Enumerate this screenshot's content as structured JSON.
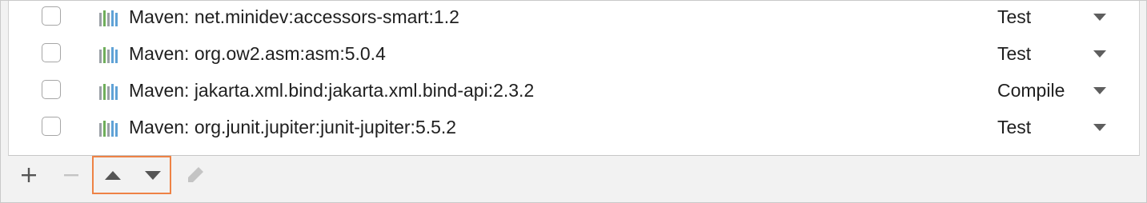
{
  "libraries": [
    {
      "name": "Maven: net.minidev:accessors-smart:1.2",
      "scope": "Test",
      "checked": false
    },
    {
      "name": "Maven: org.ow2.asm:asm:5.0.4",
      "scope": "Test",
      "checked": false
    },
    {
      "name": "Maven: jakarta.xml.bind:jakarta.xml.bind-api:2.3.2",
      "scope": "Compile",
      "checked": false
    },
    {
      "name": "Maven: org.junit.jupiter:junit-jupiter:5.5.2",
      "scope": "Test",
      "checked": false
    }
  ],
  "icons": {
    "library": "library-bars-icon",
    "dropdown": "chevron-down-icon",
    "add": "plus-icon",
    "remove": "minus-icon",
    "move_up": "triangle-up-icon",
    "move_down": "triangle-down-icon",
    "edit": "pencil-icon"
  },
  "toolbar": {
    "remove_enabled": false,
    "edit_enabled": false,
    "highlighted": [
      "move_up",
      "move_down"
    ]
  },
  "colors": {
    "highlight": "#ee8245",
    "library_icon_green": "#6fae5b",
    "library_icon_blue": "#5fa2d6",
    "library_icon_gray": "#9aa0a6",
    "disabled": "#c4c4c4"
  }
}
